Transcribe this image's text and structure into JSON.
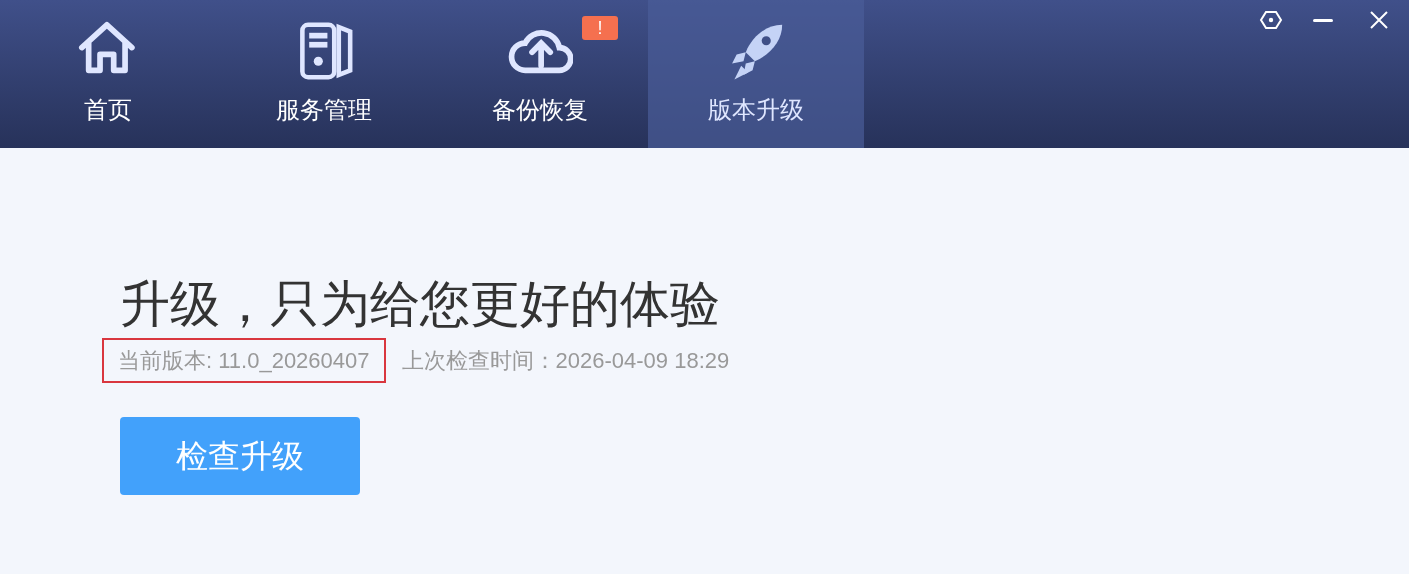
{
  "tabs": [
    {
      "label": "首页",
      "kind": "home",
      "selected": false
    },
    {
      "label": "服务管理",
      "kind": "server",
      "selected": false
    },
    {
      "label": "备份恢复",
      "kind": "cloud",
      "selected": false,
      "badge": "!"
    },
    {
      "label": "版本升级",
      "kind": "rocket",
      "selected": true
    }
  ],
  "headline": "升级，只为给您更好的体验",
  "current_version": {
    "text": "当前版本: 11.0_20260407",
    "highlighted": true
  },
  "last_check": "上次检查时间：2026-04-09 18:29",
  "check_button": "检查升级"
}
